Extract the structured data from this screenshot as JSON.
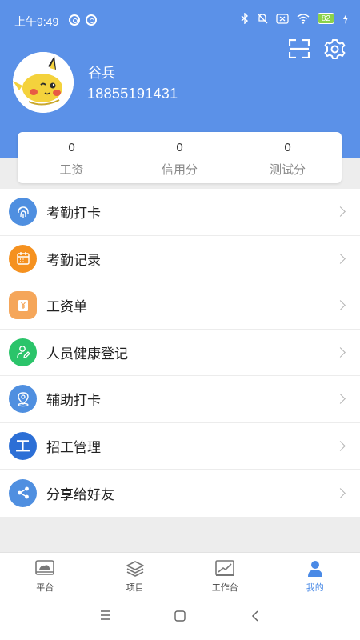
{
  "status_bar": {
    "time": "上午9:49",
    "battery": "82"
  },
  "profile": {
    "name": "谷兵",
    "phone": "18855191431"
  },
  "stats": [
    {
      "value": "0",
      "label": "工资"
    },
    {
      "value": "0",
      "label": "信用分"
    },
    {
      "value": "0",
      "label": "测试分"
    }
  ],
  "menu": [
    {
      "label": "考勤打卡",
      "icon": "fingerprint-icon",
      "color": "#4f8fe0"
    },
    {
      "label": "考勤记录",
      "icon": "calendar-icon",
      "color": "#f5911f"
    },
    {
      "label": "工资单",
      "icon": "payslip-icon",
      "color": "#f5a65a"
    },
    {
      "label": "人员健康登记",
      "icon": "person-edit-icon",
      "color": "#2bc46a"
    },
    {
      "label": "辅助打卡",
      "icon": "location-pin-icon",
      "color": "#4f8fe0"
    },
    {
      "label": "招工管理",
      "icon": "recruit-icon",
      "color": "#2c6fd6",
      "glyph": "工"
    },
    {
      "label": "分享给好友",
      "icon": "share-icon",
      "color": "#4f8fe0"
    }
  ],
  "tabs": [
    {
      "label": "平台",
      "icon": "platform-icon",
      "active": false
    },
    {
      "label": "项目",
      "icon": "layers-icon",
      "active": false
    },
    {
      "label": "工作台",
      "icon": "chart-board-icon",
      "active": false
    },
    {
      "label": "我的",
      "icon": "user-icon",
      "active": true
    }
  ],
  "colors": {
    "header_blue": "#5b91e8",
    "active_tab": "#4a8ae6"
  }
}
